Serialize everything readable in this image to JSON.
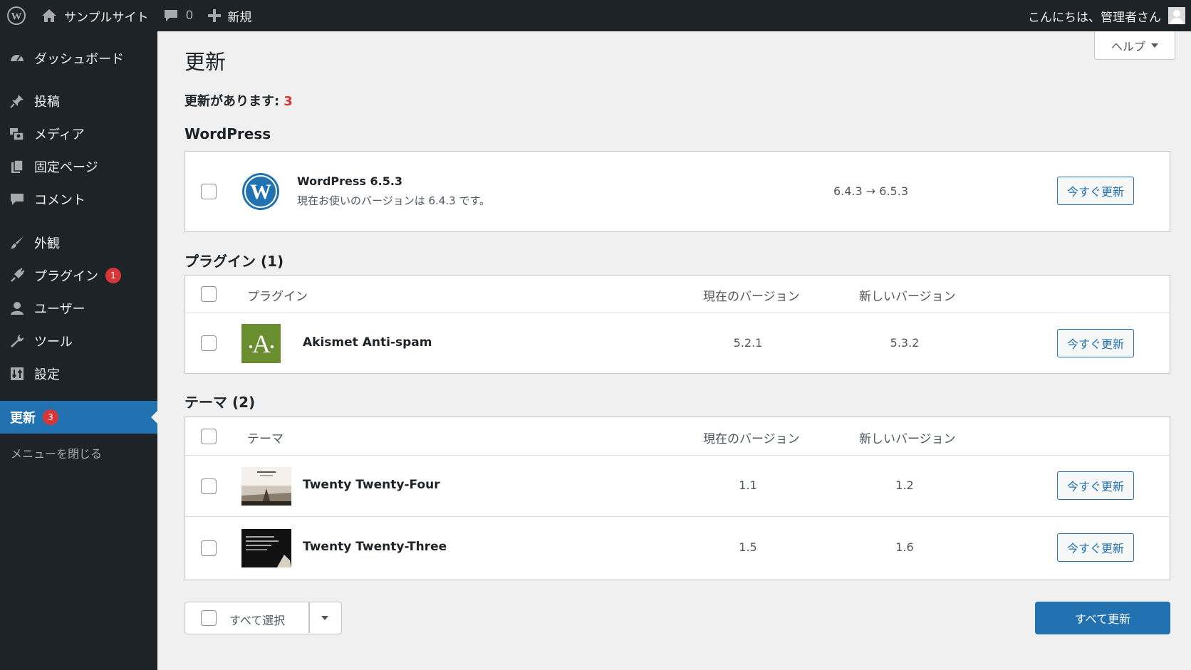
{
  "adminbar": {
    "site_name": "サンプルサイト",
    "comments_count": "0",
    "new_label": "新規",
    "greeting": "こんにちは、管理者さん"
  },
  "sidebar": {
    "items": [
      {
        "label": "ダッシュボード",
        "icon": "dashboard-icon"
      },
      {
        "label": "投稿",
        "icon": "pin-icon"
      },
      {
        "label": "メディア",
        "icon": "media-icon"
      },
      {
        "label": "固定ページ",
        "icon": "page-icon"
      },
      {
        "label": "コメント",
        "icon": "comment-icon"
      },
      {
        "label": "外観",
        "icon": "brush-icon"
      },
      {
        "label": "プラグイン",
        "icon": "plugin-icon",
        "badge": "1"
      },
      {
        "label": "ユーザー",
        "icon": "user-icon"
      },
      {
        "label": "ツール",
        "icon": "wrench-icon"
      },
      {
        "label": "設定",
        "icon": "settings-icon"
      },
      {
        "label": "更新",
        "badge": "3",
        "current": true
      }
    ],
    "collapse_label": "メニューを閉じる"
  },
  "main": {
    "help_label": "ヘルプ",
    "title": "更新",
    "available_label": "更新があります:",
    "available_count": "3",
    "wordpress": {
      "heading": "WordPress",
      "name": "WordPress 6.5.3",
      "current_text": "現在お使いのバージョンは 6.4.3 です。",
      "version_change": "6.4.3 → 6.5.3",
      "button": "今すぐ更新"
    },
    "plugins": {
      "heading": "プラグイン (1)",
      "columns": [
        "プラグイン",
        "現在のバージョン",
        "新しいバージョン"
      ],
      "rows": [
        {
          "name": "Akismet Anti-spam",
          "current": "5.2.1",
          "new": "5.3.2",
          "button": "今すぐ更新"
        }
      ]
    },
    "themes": {
      "heading": "テーマ (2)",
      "columns": [
        "テーマ",
        "現在のバージョン",
        "新しいバージョン"
      ],
      "rows": [
        {
          "name": "Twenty Twenty-Four",
          "current": "1.1",
          "new": "1.2",
          "button": "今すぐ更新"
        },
        {
          "name": "Twenty Twenty-Three",
          "current": "1.5",
          "new": "1.6",
          "button": "今すぐ更新"
        }
      ]
    },
    "select_all_label": "すべて選択",
    "update_all_label": "すべて更新"
  },
  "colors": {
    "accent": "#2271b1",
    "admin_bg": "#1d2327",
    "badge": "#d63638",
    "akismet_green": "#6a8d2f"
  }
}
